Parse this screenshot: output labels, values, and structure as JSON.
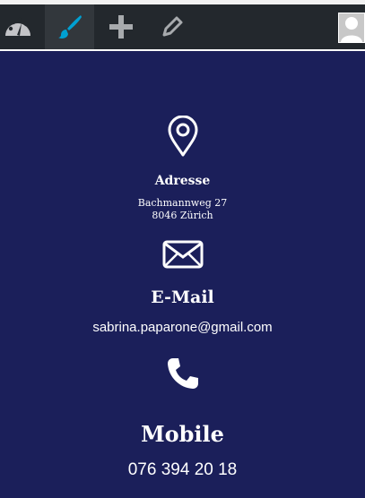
{
  "toolbar": {
    "items": [
      {
        "name": "dashboard",
        "icon": "dashboard-icon"
      },
      {
        "name": "customize",
        "icon": "paintbrush-icon",
        "active_color": "#00a0d2"
      },
      {
        "name": "new",
        "icon": "plus-icon"
      },
      {
        "name": "edit",
        "icon": "pencil-icon"
      }
    ],
    "avatar": "user-avatar"
  },
  "contact": {
    "address": {
      "icon": "map-pin-icon",
      "title": "Adresse",
      "line1": "Bachmannweg 27",
      "line2": "8046 Zürich"
    },
    "email": {
      "icon": "envelope-icon",
      "title": "E-Mail",
      "value": "sabrina.paparone@gmail.com"
    },
    "mobile": {
      "icon": "phone-icon",
      "title": "Mobile",
      "value": "076 394 20 18"
    }
  },
  "colors": {
    "background": "#1b1f5a",
    "adminbar": "#23282d",
    "accent": "#00a0d2",
    "text": "#ffffff"
  }
}
